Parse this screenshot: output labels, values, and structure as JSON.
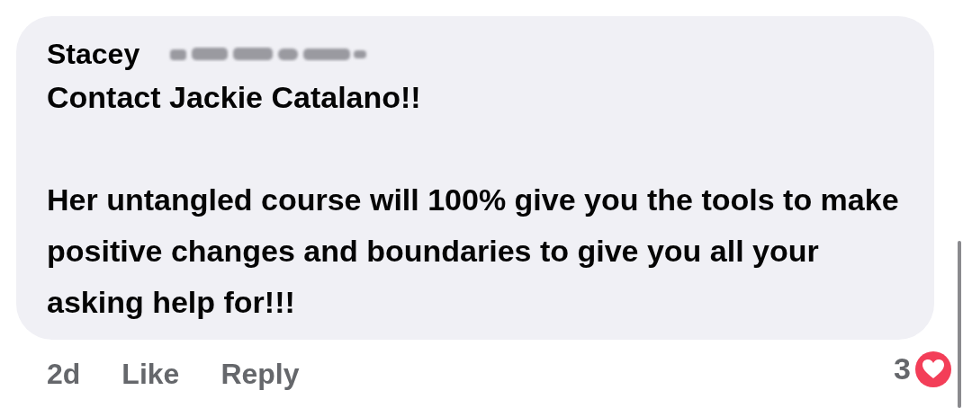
{
  "comment": {
    "author": "Stacey",
    "paragraphs": [
      "Contact Jackie Catalano!!",
      "Her untangled course will 100% give you the tools to make positive changes and boundaries to give you all your asking help for!!!"
    ],
    "time": "2d",
    "actions": [
      "Like",
      "Reply"
    ],
    "reaction_count": "3"
  }
}
